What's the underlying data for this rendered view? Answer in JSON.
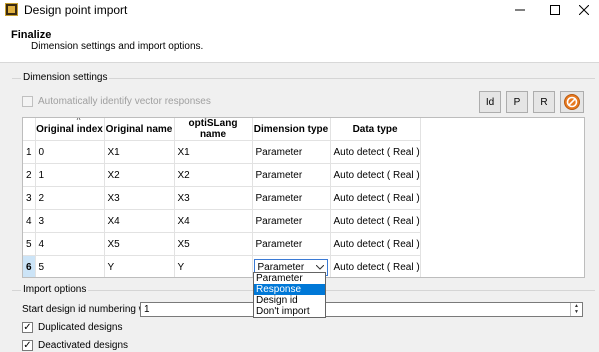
{
  "window": {
    "title": "Design point import"
  },
  "header": {
    "title": "Finalize",
    "subtitle": "Dimension settings and import options."
  },
  "dimension_settings": {
    "label": "Dimension settings",
    "auto_identify_label": "Automatically identify vector responses",
    "auto_identify_checked": false,
    "buttons": [
      "Id",
      "P",
      "R"
    ]
  },
  "table": {
    "columns": [
      "Original index",
      "Original name",
      "optiSLang name",
      "Dimension type",
      "Data type"
    ],
    "rows": [
      {
        "n": "1",
        "index": "0",
        "orig": "X1",
        "name": "X1",
        "dim": "Parameter",
        "dtype": "Auto detect ( Real )"
      },
      {
        "n": "2",
        "index": "1",
        "orig": "X2",
        "name": "X2",
        "dim": "Parameter",
        "dtype": "Auto detect ( Real )"
      },
      {
        "n": "3",
        "index": "2",
        "orig": "X3",
        "name": "X3",
        "dim": "Parameter",
        "dtype": "Auto detect ( Real )"
      },
      {
        "n": "4",
        "index": "3",
        "orig": "X4",
        "name": "X4",
        "dim": "Parameter",
        "dtype": "Auto detect ( Real )"
      },
      {
        "n": "5",
        "index": "4",
        "orig": "X5",
        "name": "X5",
        "dim": "Parameter",
        "dtype": "Auto detect ( Real )"
      },
      {
        "n": "6",
        "index": "5",
        "orig": "Y",
        "name": "Y",
        "dim": "Parameter",
        "dtype": "Auto detect ( Real )"
      }
    ],
    "selected_row": 6,
    "dropdown_options": [
      "Parameter",
      "Response",
      "Design id",
      "Don't import"
    ],
    "dropdown_highlighted": "Response"
  },
  "import_options": {
    "label": "Import options",
    "start_label": "Start design id numbering with:",
    "start_value": "1",
    "duplicated_label": "Duplicated designs",
    "duplicated_checked": true,
    "deactivated_label": "Deactivated designs",
    "deactivated_checked": true
  },
  "colors": {
    "selection": "#cce4f7",
    "highlight": "#0078d7",
    "orange_icon": "#e8791f"
  }
}
